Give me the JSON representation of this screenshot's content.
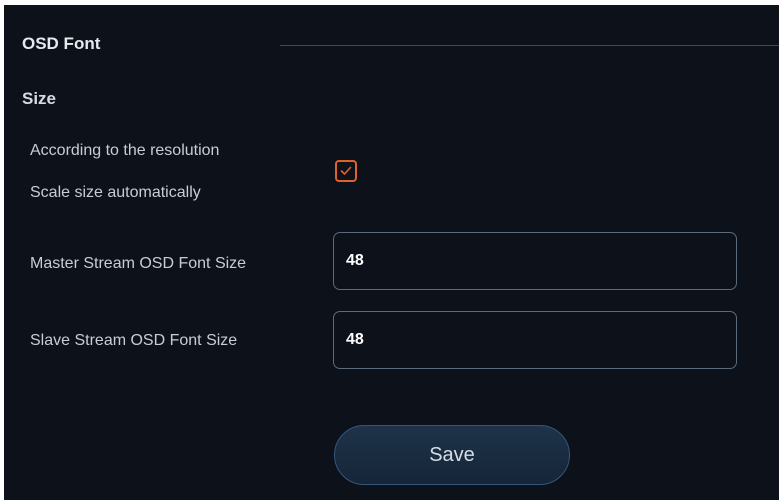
{
  "section": {
    "title": "OSD Font",
    "subtitle": "Size"
  },
  "auto_scale": {
    "label_line1": "According to the resolution",
    "label_line2": "Scale size automatically",
    "checked": true
  },
  "master_stream": {
    "label": "Master Stream OSD Font Size",
    "value": "48"
  },
  "slave_stream": {
    "label": "Slave Stream OSD Font Size",
    "value": "48"
  },
  "actions": {
    "save_label": "Save"
  },
  "colors": {
    "background": "#0c111a",
    "accent": "#e0622a",
    "button_fill": "#1b2d42"
  }
}
